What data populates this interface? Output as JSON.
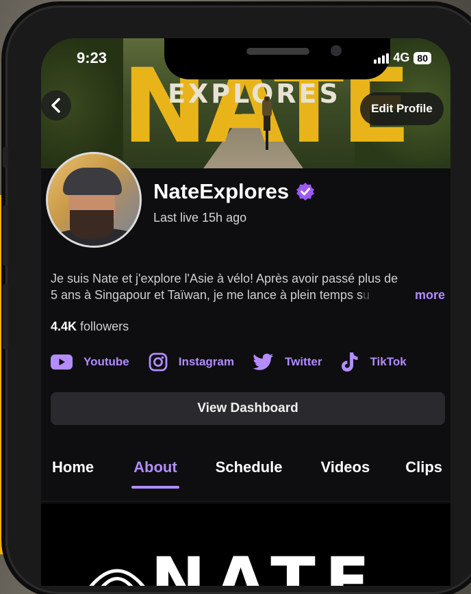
{
  "status_bar": {
    "time": "9:23",
    "network": "4G",
    "battery": "80"
  },
  "banner": {
    "big_text": "NATE",
    "sub_text": "EXPLORES"
  },
  "header": {
    "back_icon": "chevron-left-icon",
    "edit_profile_label": "Edit Profile"
  },
  "profile": {
    "username": "NateExplores",
    "verified_icon": "verified-badge-icon",
    "last_live": "Last live 15h ago",
    "bio_line1": "Je suis Nate et j'explore l'Asie à vélo! Après avoir passé plus de",
    "bio_line2": "5 ans à Singapour et Taïwan, je me lance à plein temps s",
    "bio_fade": "u",
    "more_label": "more",
    "followers_count": "4.4K",
    "followers_label": "followers"
  },
  "socials": [
    {
      "label": "Youtube",
      "icon": "youtube-icon"
    },
    {
      "label": "Instagram",
      "icon": "instagram-icon"
    },
    {
      "label": "Twitter",
      "icon": "twitter-icon"
    },
    {
      "label": "TikTok",
      "icon": "tiktok-icon"
    }
  ],
  "dashboard_label": "View Dashboard",
  "tabs": [
    {
      "label": "Home",
      "active": false
    },
    {
      "label": "About",
      "active": true
    },
    {
      "label": "Schedule",
      "active": false
    },
    {
      "label": "Videos",
      "active": false
    },
    {
      "label": "Clips",
      "active": false
    }
  ],
  "lower_card": {
    "text": "NATE"
  },
  "colors": {
    "accent": "#b38cff",
    "banner_yellow": "#e9b419",
    "background": "#0e0e10"
  }
}
